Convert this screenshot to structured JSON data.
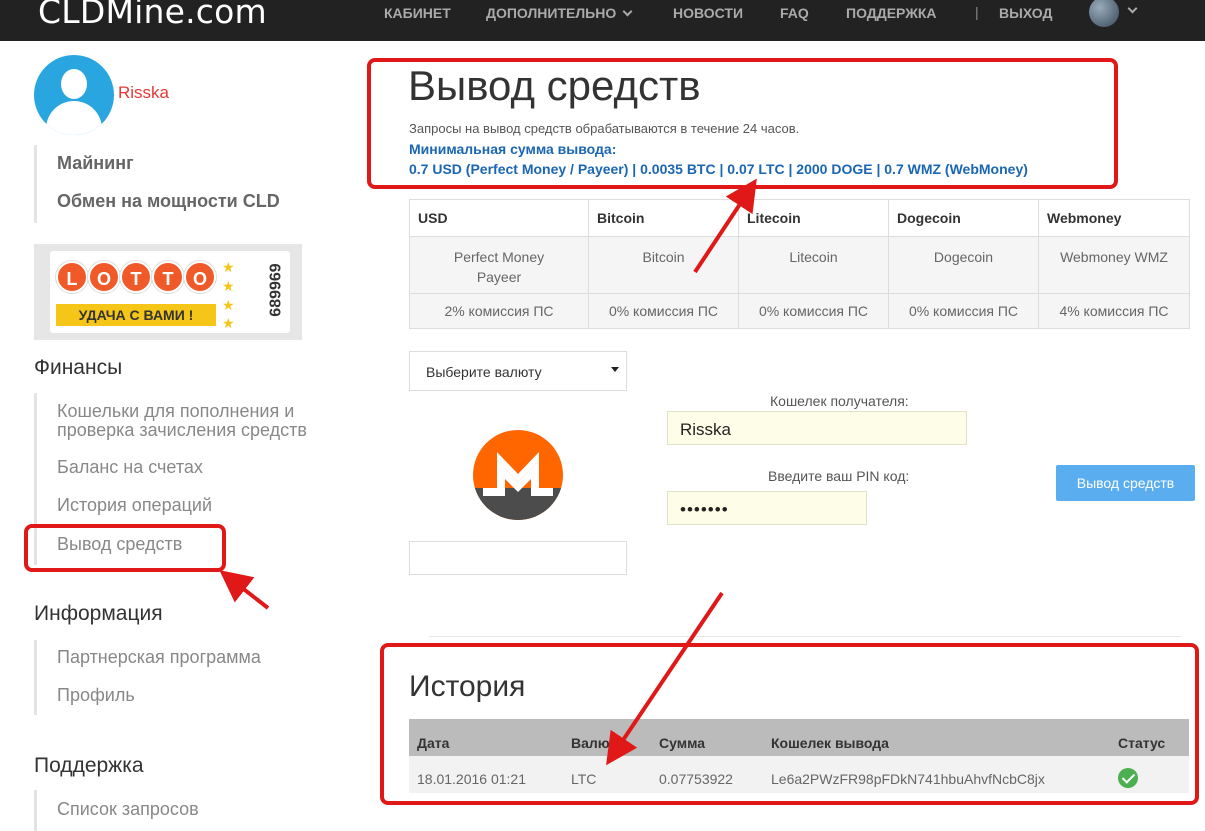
{
  "navbar": {
    "brand": "CLDMine.com",
    "items": [
      {
        "label": "КАБИНЕТ"
      },
      {
        "label": "ДОПОЛНИТЕЛЬНО"
      },
      {
        "label": "НОВОСТИ"
      },
      {
        "label": "FAQ"
      },
      {
        "label": "ПОДДЕРЖКА"
      },
      {
        "label": "ВЫХОД"
      }
    ],
    "separator": "|"
  },
  "sidebar": {
    "username": "Risska",
    "top_links": [
      "Майнинг",
      "Обмен на мощности CLD"
    ],
    "lotto": {
      "letters": [
        "L",
        "O",
        "T",
        "T",
        "O"
      ],
      "banner": "УДАЧА С ВАМИ !",
      "number": "689969"
    },
    "finance": {
      "heading": "Финансы",
      "links": [
        "Кошельки для пополнения и",
        "проверка зачисления средств",
        "Баланс на счетах",
        "История операций",
        "Вывод средств"
      ]
    },
    "info": {
      "heading": "Информация",
      "links": [
        "Партнерская программа",
        "Профиль"
      ]
    },
    "support": {
      "heading": "Поддержка",
      "links": [
        "Список запросов"
      ]
    }
  },
  "main": {
    "title": "Вывод средств",
    "info_text": "Запросы на вывод средств обрабатываются в течение 24 часов.",
    "min_label": "Минимальная сумма вывода:",
    "min_values": "0.7 USD (Perfect Money / Payeer) | 0.0035 BTC | 0.07 LTC | 2000 DOGE | 0.7 WMZ (WebMoney)",
    "currencies": [
      {
        "head": "USD",
        "systems": [
          "Perfect Money",
          "Payeer"
        ],
        "fee": "2% комиссия ПС"
      },
      {
        "head": "Bitcoin",
        "systems": [
          "Bitcoin"
        ],
        "fee": "0% комиссия ПС"
      },
      {
        "head": "Litecoin",
        "systems": [
          "Litecoin"
        ],
        "fee": "0% комиссия ПС"
      },
      {
        "head": "Dogecoin",
        "systems": [
          "Dogecoin"
        ],
        "fee": "0% комиссия ПС"
      },
      {
        "head": "Webmoney",
        "systems": [
          "Webmoney WMZ"
        ],
        "fee": "4% комиссия ПС"
      }
    ],
    "select_value": "Выберите валюту",
    "wallet_label": "Кошелек получателя:",
    "wallet_value": "Risska",
    "pin_label": "Введите ваш PIN код:",
    "pin_value": "•••••••",
    "submit_label": "Вывод средств"
  },
  "history": {
    "title": "История",
    "columns": [
      "Дата",
      "Валюта",
      "Сумма",
      "Кошелек вывода",
      "Статус"
    ],
    "rows": [
      {
        "date": "18.01.2016 01:21",
        "currency": "LTC",
        "amount": "0.07753922",
        "wallet": "Le6a2PWzFR98pFDkN741hbuAhvfNcbC8jx",
        "status": "ok"
      }
    ]
  },
  "colors": {
    "navbar": "#222222",
    "accent_link": "#1a66b3",
    "username": "#e53935",
    "submit": "#5aaef0",
    "annotation": "#e01818"
  }
}
